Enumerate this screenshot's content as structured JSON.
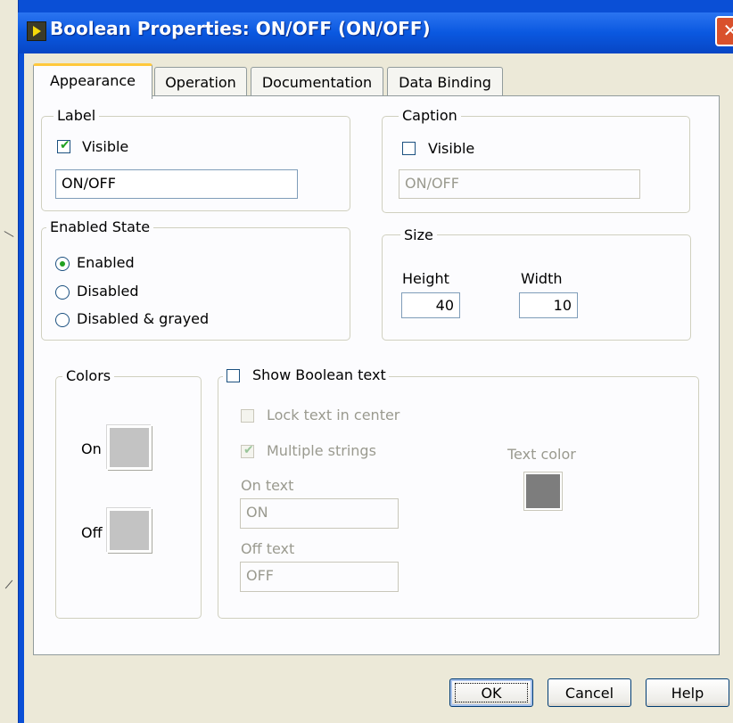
{
  "window": {
    "title": "Boolean Properties: ON/OFF (ON/OFF)",
    "close_glyph": "✕",
    "icon": "labview-icon"
  },
  "tabs": [
    {
      "label": "Appearance",
      "active": true
    },
    {
      "label": "Operation",
      "active": false
    },
    {
      "label": "Documentation",
      "active": false
    },
    {
      "label": "Data Binding",
      "active": false
    }
  ],
  "label_group": {
    "legend": "Label",
    "visible_label": "Visible",
    "visible_checked": true,
    "value": "ON/OFF"
  },
  "caption_group": {
    "legend": "Caption",
    "visible_label": "Visible",
    "visible_checked": false,
    "value": "ON/OFF"
  },
  "enabled_state": {
    "legend": "Enabled State",
    "options": [
      "Enabled",
      "Disabled",
      "Disabled & grayed"
    ],
    "selected": "Enabled"
  },
  "size": {
    "legend": "Size",
    "height_label": "Height",
    "height_value": "40",
    "width_label": "Width",
    "width_value": "10"
  },
  "colors": {
    "legend": "Colors",
    "on_label": "On",
    "off_label": "Off",
    "on_color": "#c3c3c3",
    "off_color": "#c3c3c3"
  },
  "boolean_text": {
    "show_label": "Show Boolean text",
    "show_checked": false,
    "lock_label": "Lock text in center",
    "lock_checked": false,
    "multiple_label": "Multiple strings",
    "multiple_checked": true,
    "on_text_label": "On text",
    "on_text_value": "ON",
    "off_text_label": "Off text",
    "off_text_value": "OFF",
    "text_color_label": "Text color",
    "text_color": "#7d7d7d"
  },
  "buttons": {
    "ok": "OK",
    "cancel": "Cancel",
    "help": "Help"
  }
}
